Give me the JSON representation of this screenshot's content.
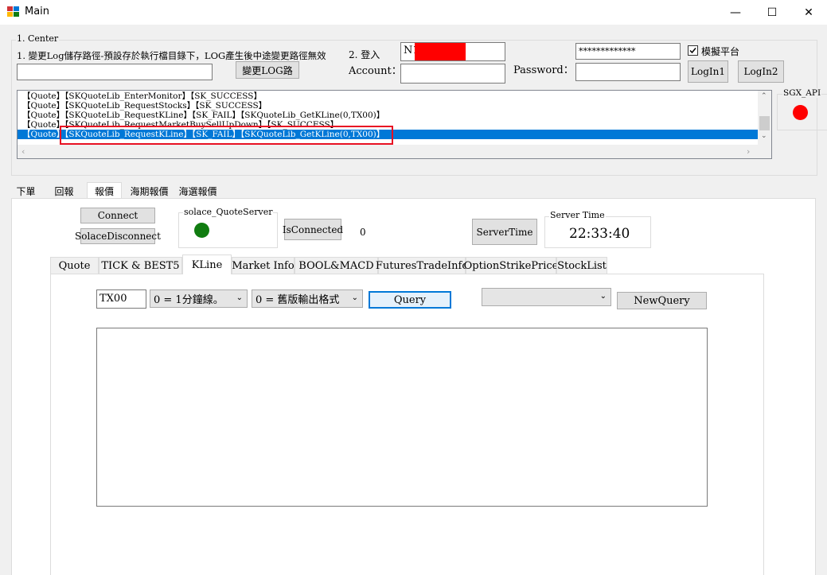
{
  "window": {
    "title": "Main",
    "minimize_glyph": "—",
    "maximize_glyph": "☐",
    "close_glyph": "✕"
  },
  "center": {
    "group_label": "1. Center",
    "log_path_label": "1. 變更Log儲存路徑-預設存於執行檔目錄下，LOG產生後中途變更路徑無效",
    "log_path_value": "",
    "change_log_button": "變更LOG路",
    "login_label": "2. 登入",
    "account_label": "Account：",
    "account_top_value": "N1",
    "account_value": "",
    "password_label": "Password：",
    "password_value": "*************",
    "password2_value": "",
    "simulate_label": "模擬平台",
    "simulate_checked": true,
    "login1_button": "LogIn1",
    "login2_button": "LogIn2",
    "sgx_label": "SGX_API",
    "sgx_status_color": "#ff0000"
  },
  "log": {
    "lines": [
      "【Quote】【SKQuoteLib_EnterMonitor】【SK_SUCCESS】",
      "【Quote】【SKQuoteLib_RequestStocks】【SK_SUCCESS】",
      "【Quote】【SKQuoteLib_RequestKLine】【SK_FAIL】【SKQuoteLib_GetKLine(0,TX00)】",
      "【Quote】【SKQuoteLib_RequestMarketBuySellUpDown】【SK_SUCCESS】",
      "【Quote】【SKQuoteLib_RequestKLine】【SK_FAIL】【SKQuoteLib_GetKLine(0,TX00)】"
    ],
    "selected_index": 4
  },
  "main_tabs": [
    "下單",
    "回報",
    "報價",
    "海期報價",
    "海選報價"
  ],
  "main_active_tab": 2,
  "quote_panel": {
    "connect_button": "Connect",
    "solace_disconnect_button": "SolaceDisconnect",
    "solace_group_label": "solace_QuoteServer",
    "solace_status_color": "#107c10",
    "is_connected_button": "IsConnected",
    "is_connected_value": "0",
    "server_time_button": "ServerTime",
    "server_time_group_label": "Server Time",
    "server_time_value": "22:33:40"
  },
  "sub_tabs": [
    "Quote",
    "TICK & BEST5",
    "KLine",
    "Market Info",
    "BOOL&MACD",
    "FuturesTradeInfo",
    "OptionStrikePrice",
    "StockList"
  ],
  "sub_active_tab": 2,
  "kline": {
    "symbol_value": "TX00",
    "kline_type": "0 = 1分鐘線。",
    "output_format": "0 = 舊版輸出格式",
    "query_button": "Query",
    "new_query_combo": "",
    "new_query_button": "NewQuery",
    "output_text": ""
  },
  "accent": {
    "selection": "#0078d7",
    "highlight_border": "#e81123",
    "redact": "#ff0000"
  }
}
